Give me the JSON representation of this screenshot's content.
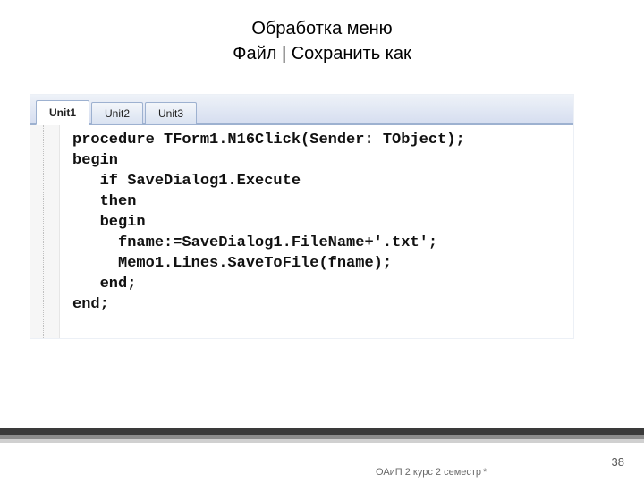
{
  "title": {
    "line1": "Обработка меню",
    "line2": "Файл | Сохранить как"
  },
  "ide": {
    "tabs": [
      {
        "label": "Unit1",
        "active": true
      },
      {
        "label": "Unit2",
        "active": false
      },
      {
        "label": "Unit3",
        "active": false
      }
    ],
    "code": "procedure TForm1.N16Click(Sender: TObject);\nbegin\n   if SaveDialog1.Execute\n   then\n   begin\n     fname:=SaveDialog1.FileName+'.txt';\n     Memo1.Lines.SaveToFile(fname);\n   end;\nend;"
  },
  "footer": {
    "course": "ОАиП 2 курс 2 семестр",
    "date": "*",
    "slide_number": "38"
  }
}
